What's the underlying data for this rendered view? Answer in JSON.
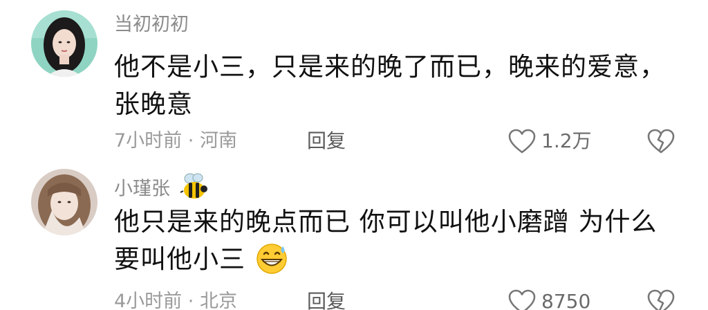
{
  "comments": [
    {
      "username": "当初初初",
      "text": "他不是小三，只是来的晚了而已，晚来的爱意，张晚意",
      "time": "7小时前",
      "location": "河南",
      "meta_separator": "·",
      "reply_label": "回复",
      "likes": "1.2万"
    },
    {
      "username": "小瑾张",
      "badge_icon": "bee-icon",
      "text": "他只是来的晚点而已 你可以叫他小磨蹭 为什么要叫他小三",
      "emoji_icon": "grinning-sweat-emoji-icon",
      "time": "4小时前",
      "location": "北京",
      "meta_separator": "·",
      "reply_label": "回复",
      "likes": "8750"
    }
  ]
}
